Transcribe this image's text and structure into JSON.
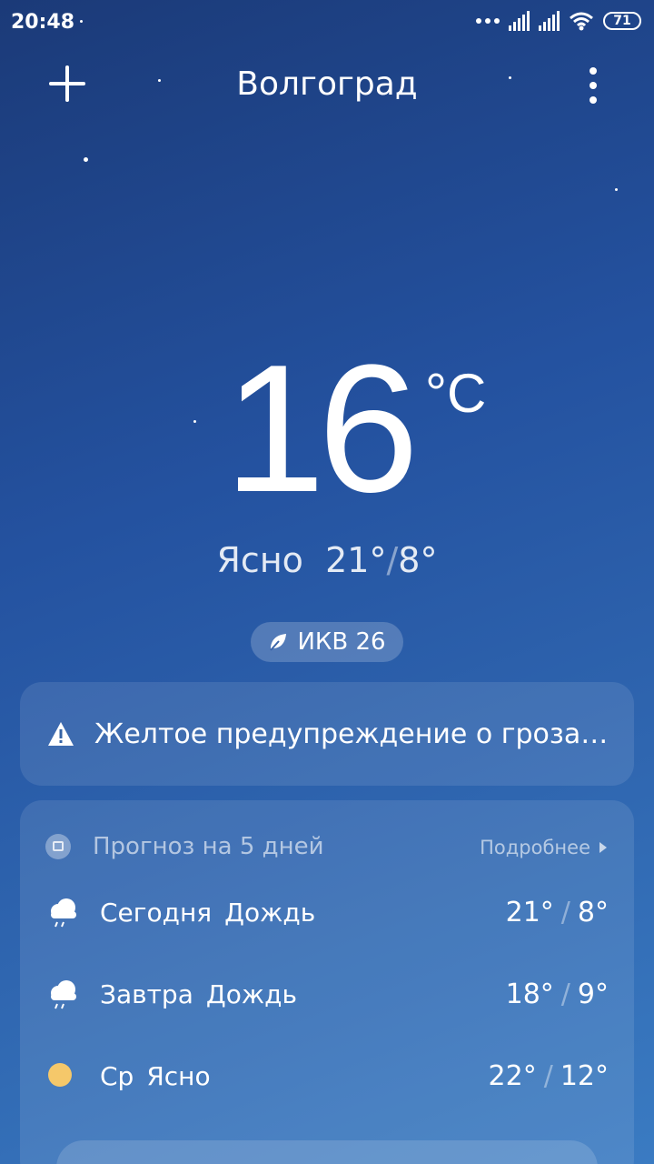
{
  "status_bar": {
    "time": "20:48",
    "battery": "71"
  },
  "header": {
    "city": "Волгоград",
    "add_icon": "plus-icon",
    "menu_icon": "more-vertical-icon"
  },
  "current": {
    "temperature": "16",
    "unit": "°C",
    "condition": "Ясно",
    "high": "21°",
    "low": "8°",
    "aqi_label": "ИКВ 26"
  },
  "warning": {
    "text": "Желтое предупреждение о грозах и ливнях",
    "icon": "warning-icon"
  },
  "forecast": {
    "title": "Прогноз на 5 дней",
    "more_label": "Подробнее",
    "days": [
      {
        "day": "Сегодня",
        "condition": "Дождь",
        "high": "21°",
        "low": "8°",
        "icon": "rain-icon"
      },
      {
        "day": "Завтра",
        "condition": "Дождь",
        "high": "18°",
        "low": "9°",
        "icon": "rain-icon"
      },
      {
        "day": "Ср",
        "condition": "Ясно",
        "high": "22°",
        "low": "12°",
        "icon": "sun-icon"
      }
    ]
  },
  "colors": {
    "background_top": "#1b3a78",
    "background_bottom": "#3a7bc2",
    "sun": "#f5c86a"
  }
}
